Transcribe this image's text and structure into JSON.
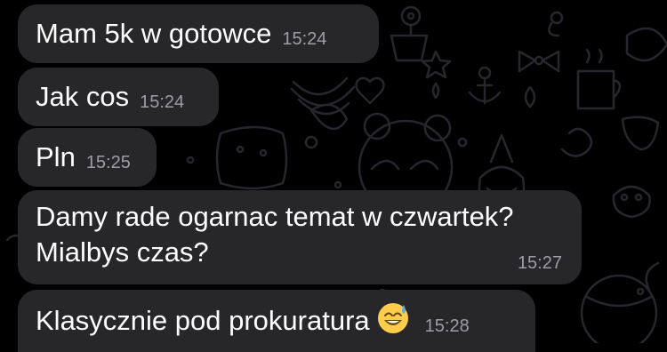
{
  "colors": {
    "background": "#000000",
    "bubble": "#272729",
    "message_text": "#ffffff",
    "timestamp": "#9d9da3",
    "wallpaper_doodle": "#2a2a33"
  },
  "messages": [
    {
      "text": "Mam 5k w gotowce",
      "time": "15:24"
    },
    {
      "text": "Jak cos",
      "time": "15:24"
    },
    {
      "text": "Pln",
      "time": "15:25"
    },
    {
      "text_line1": "Damy rade ogarnac temat w czwartek?",
      "text_line2": "Mialbys czas?",
      "time": "15:27"
    },
    {
      "text": "Klasycznie pod prokuratura",
      "emoji": "sweat-smile-emoji",
      "time": "15:28"
    }
  ]
}
